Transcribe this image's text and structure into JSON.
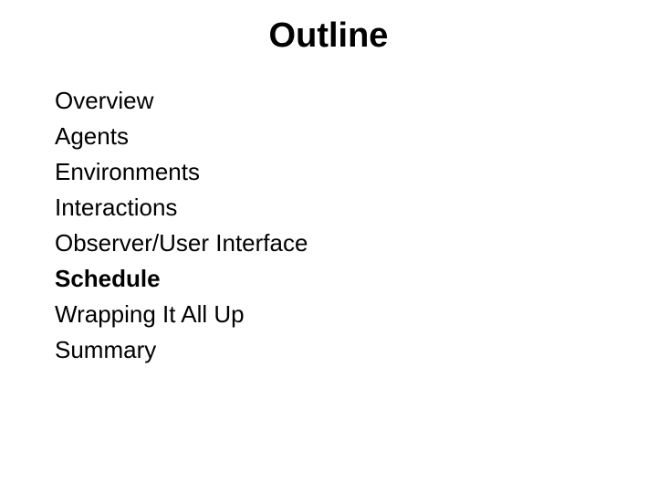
{
  "title": "Outline",
  "items": [
    {
      "label": "Overview",
      "bold": false
    },
    {
      "label": "Agents",
      "bold": false
    },
    {
      "label": "Environments",
      "bold": false
    },
    {
      "label": "Interactions",
      "bold": false
    },
    {
      "label": "Observer/User Interface",
      "bold": false
    },
    {
      "label": "Schedule",
      "bold": true
    },
    {
      "label": "Wrapping It All Up",
      "bold": false
    },
    {
      "label": "Summary",
      "bold": false
    }
  ]
}
